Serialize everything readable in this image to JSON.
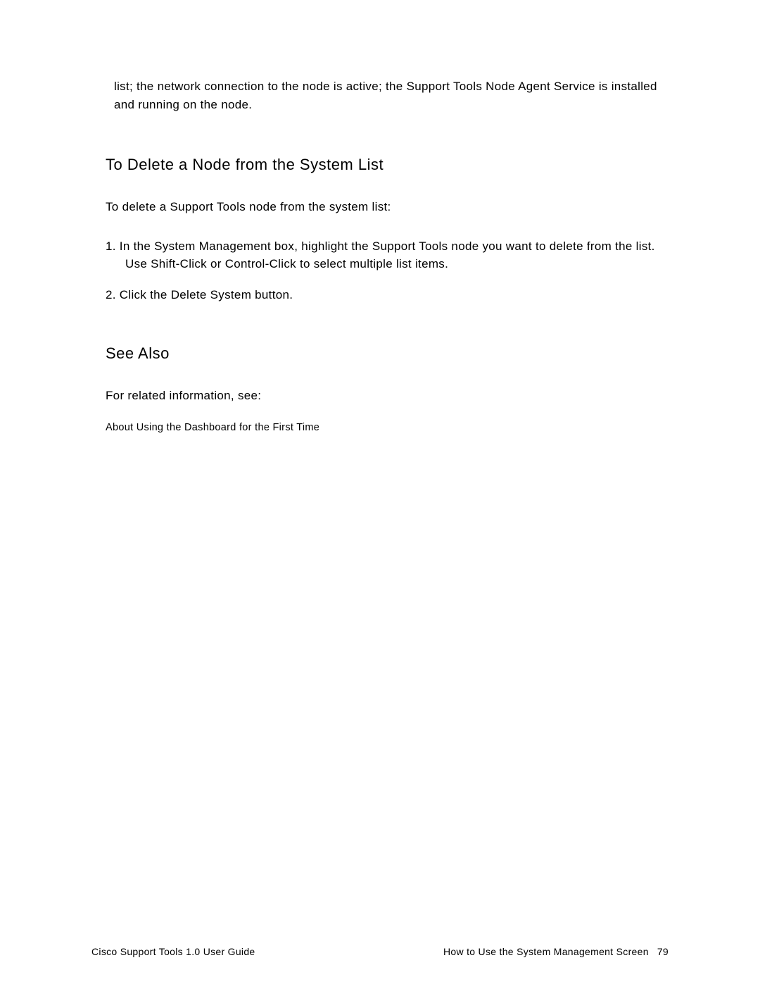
{
  "continuation": "list; the network connection to the node is active; the Support Tools Node Agent Service is installed and running on the node.",
  "heading_delete": "To Delete a Node from the System List",
  "intro_delete": "To delete a Support Tools node from the system list:",
  "step1": "1.  In the System Management box, highlight the Support Tools node you want to delete from the list. Use Shift-Click or Control-Click to select multiple list items.",
  "step2": "2.  Click the Delete System button.",
  "heading_seealso": "See Also",
  "see_also_intro": "For related information, see:",
  "link": "About Using the Dashboard for the First Time",
  "footer_left": "Cisco Support Tools 1.0 User Guide",
  "footer_right_title": "How to Use the System Management Screen",
  "footer_page": "79"
}
